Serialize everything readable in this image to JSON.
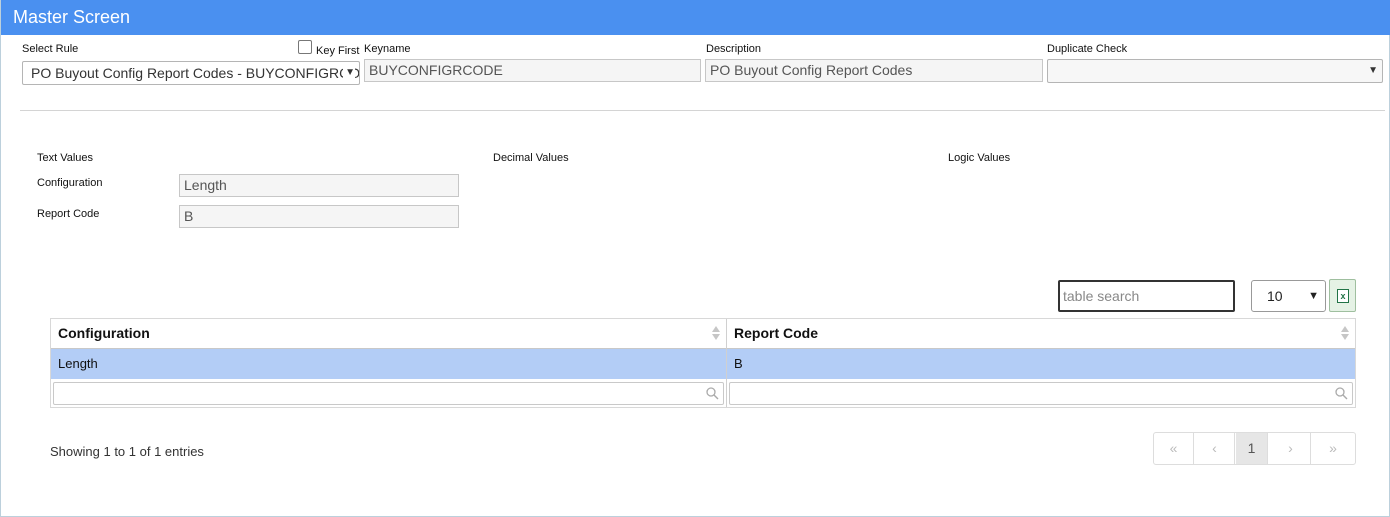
{
  "window": {
    "title": "Master Screen"
  },
  "form": {
    "select_rule_label": "Select Rule",
    "select_rule_value": "PO Buyout Config Report Codes - BUYCONFIGRCODE",
    "key_first_label": "Key First",
    "keyname_label": "Keyname",
    "keyname_value": "BUYCONFIGRCODE",
    "description_label": "Description",
    "description_value": "PO Buyout Config Report Codes",
    "duplicate_check_label": "Duplicate Check",
    "duplicate_check_value": ""
  },
  "values": {
    "text_values_label": "Text Values",
    "decimal_values_label": "Decimal Values",
    "logic_values_label": "Logic Values",
    "configuration_label": "Configuration",
    "configuration_value": "Length",
    "report_code_label": "Report Code",
    "report_code_value": "B"
  },
  "table": {
    "search_placeholder": "table search",
    "page_size": "10",
    "columns": [
      "Configuration",
      "Report Code"
    ],
    "rows": [
      [
        "Length",
        "B"
      ]
    ],
    "info": "Showing 1 to 1 of 1 entries",
    "pager": {
      "first": "«",
      "prev": "‹",
      "current": "1",
      "next": "›",
      "last": "»"
    }
  },
  "colors": {
    "titlebar": "#4a90f0",
    "selected_row": "#b3cdf6",
    "excel_green": "#217346"
  },
  "icons": [
    "chevron-down-icon",
    "sort-icon",
    "search-icon",
    "excel-export-icon"
  ]
}
